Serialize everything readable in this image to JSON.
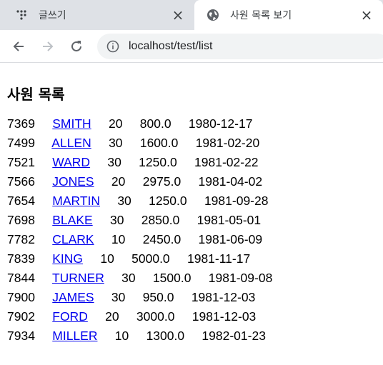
{
  "tabs": [
    {
      "title": "글쓰기",
      "active": false,
      "icon": "app-dots-icon"
    },
    {
      "title": "사원 목록 보기",
      "active": true,
      "icon": "globe-icon"
    }
  ],
  "toolbar": {
    "back_icon": "back-arrow-icon",
    "forward_icon": "forward-arrow-icon",
    "reload_icon": "reload-icon",
    "url": "localhost/test/list"
  },
  "page": {
    "heading": "사원 목록",
    "employees": [
      {
        "empno": "7369",
        "ename": "SMITH",
        "deptno": "20",
        "sal": "800.0",
        "hiredate": "1980-12-17"
      },
      {
        "empno": "7499",
        "ename": "ALLEN",
        "deptno": "30",
        "sal": "1600.0",
        "hiredate": "1981-02-20"
      },
      {
        "empno": "7521",
        "ename": "WARD",
        "deptno": "30",
        "sal": "1250.0",
        "hiredate": "1981-02-22"
      },
      {
        "empno": "7566",
        "ename": "JONES",
        "deptno": "20",
        "sal": "2975.0",
        "hiredate": "1981-04-02"
      },
      {
        "empno": "7654",
        "ename": "MARTIN",
        "deptno": "30",
        "sal": "1250.0",
        "hiredate": "1981-09-28"
      },
      {
        "empno": "7698",
        "ename": "BLAKE",
        "deptno": "30",
        "sal": "2850.0",
        "hiredate": "1981-05-01"
      },
      {
        "empno": "7782",
        "ename": "CLARK",
        "deptno": "10",
        "sal": "2450.0",
        "hiredate": "1981-06-09"
      },
      {
        "empno": "7839",
        "ename": "KING",
        "deptno": "10",
        "sal": "5000.0",
        "hiredate": "1981-11-17"
      },
      {
        "empno": "7844",
        "ename": "TURNER",
        "deptno": "30",
        "sal": "1500.0",
        "hiredate": "1981-09-08"
      },
      {
        "empno": "7900",
        "ename": "JAMES",
        "deptno": "30",
        "sal": "950.0",
        "hiredate": "1981-12-03"
      },
      {
        "empno": "7902",
        "ename": "FORD",
        "deptno": "20",
        "sal": "3000.0",
        "hiredate": "1981-12-03"
      },
      {
        "empno": "7934",
        "ename": "MILLER",
        "deptno": "10",
        "sal": "1300.0",
        "hiredate": "1982-01-23"
      }
    ]
  }
}
